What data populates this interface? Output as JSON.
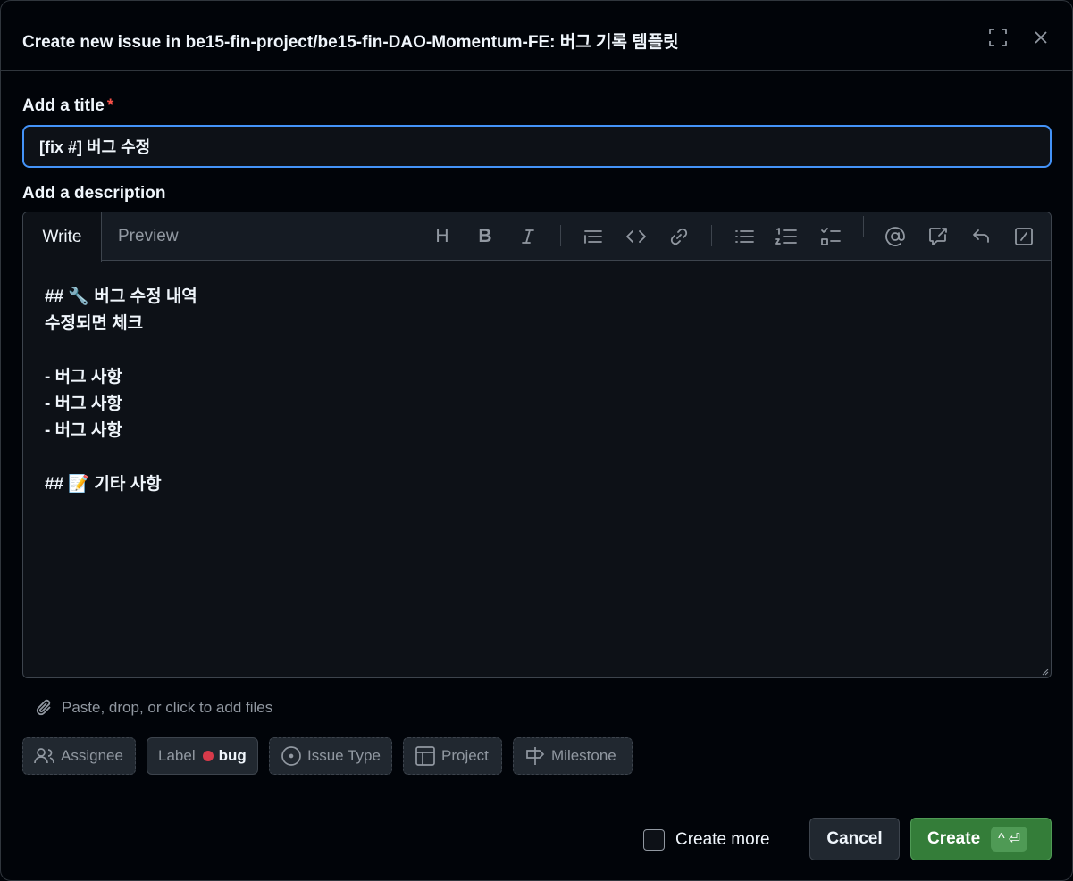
{
  "header": {
    "title": "Create new issue in be15-fin-project/be15-fin-DAO-Momentum-FE: 버그 기록 템플릿",
    "expand_icon": "fullscreen-icon",
    "close_icon": "close-icon"
  },
  "title_field": {
    "label": "Add a title",
    "required_mark": "*",
    "value": "[fix #] 버그 수정"
  },
  "description": {
    "label": "Add a description",
    "tabs": [
      "Write",
      "Preview"
    ],
    "toolbar": {
      "heading": "H",
      "bold": "B",
      "icons": [
        "heading-icon",
        "bold-icon",
        "italic-icon",
        "quote-icon",
        "code-icon",
        "link-icon",
        "bulleted-list-icon",
        "numbered-list-icon",
        "task-list-icon",
        "mention-icon",
        "reference-icon",
        "reply-icon",
        "slash-command-icon"
      ]
    },
    "body_lines": [
      "## 🔧 버그 수정 내역",
      "수정되면 체크",
      "",
      "- 버그 사항",
      "- 버그 사항",
      "- 버그 사항",
      "",
      "## 📝 기타 사항"
    ]
  },
  "attach": {
    "text": "Paste, drop, or click to add files"
  },
  "metadata": {
    "assignee": "Assignee",
    "label": "Label",
    "label_value": "bug",
    "label_color": "#d73a4a",
    "issue_type": "Issue Type",
    "project": "Project",
    "milestone": "Milestone"
  },
  "footer": {
    "create_more": "Create more",
    "cancel": "Cancel",
    "create": "Create",
    "shortcut_caret": "^",
    "shortcut_key": "⏎"
  },
  "colors": {
    "accent_focus": "#4493f8",
    "create_green": "#347d39",
    "background": "#010409"
  }
}
